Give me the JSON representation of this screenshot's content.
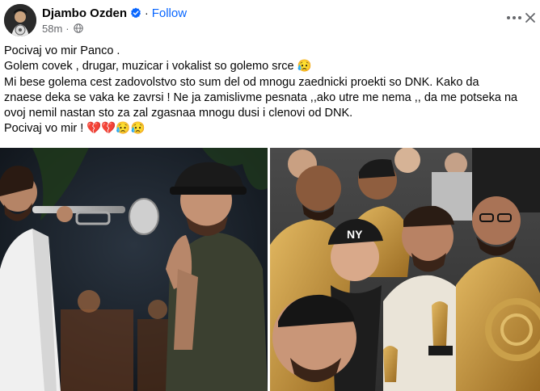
{
  "header": {
    "author_name": "Djambo Ozden",
    "separator": "·",
    "follow_label": "Follow",
    "timestamp": "58m",
    "timestamp_separator": "·",
    "more_icon": "more-dots-icon",
    "close_icon": "close-icon",
    "verified_icon": "verified-badge-icon",
    "privacy_icon": "globe-icon"
  },
  "post": {
    "lines": [
      "Pocivaj vo mir Panco .",
      "Golem covek , drugar, muzicar i vokalist so golemo srce 😥",
      "Mi bese golema cest zadovolstvo sto sum del od mnogu zaednicki proekti so DNK.  Kako da",
      "znaese deka se vaka ke zavrsi !  Ne ja zamislivme pesnata ,,ako utre me nema ,, da me potseka na",
      "ovoj nemil nastan sto za zal zgasnaa mnogu dusi i clenovi od DNK.",
      "Pocivaj vo mir  ! 💔💔😥😥"
    ]
  },
  "photos": {
    "left_alt": "music-video-still-photo",
    "right_alt": "group-selfie-photo",
    "cap_text": "NY"
  },
  "colors": {
    "accent": "#0866ff",
    "muted": "#65676b",
    "text": "#050505"
  }
}
